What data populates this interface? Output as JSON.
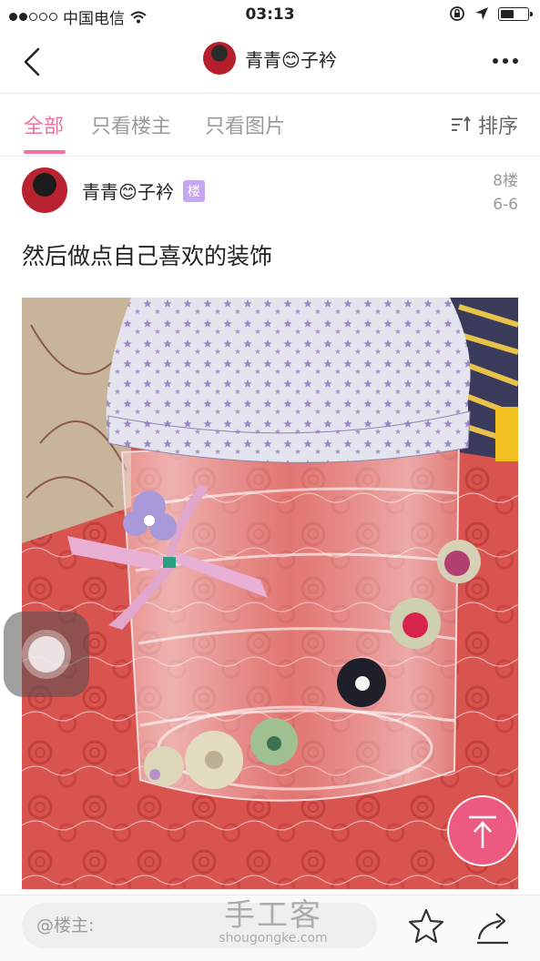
{
  "status_bar": {
    "carrier": "中国电信",
    "time": "03:13",
    "signal_bars": 2,
    "battery_level": 0.5
  },
  "nav": {
    "title": "青青😊子衿"
  },
  "tabs": [
    {
      "label": "全部",
      "active": true
    },
    {
      "label": "只看楼主",
      "active": false
    },
    {
      "label": "只看图片",
      "active": false
    }
  ],
  "sort_label": "排序",
  "post": {
    "author": "青青😊子衿",
    "badge": "楼",
    "floor": "8楼",
    "date": "6-6",
    "text": "然后做点自己喜欢的装饰"
  },
  "reply_placeholder": "@楼主:",
  "watermark": {
    "main": "手工客",
    "sub": "shougongke.com"
  },
  "colors": {
    "accent": "#f0729a",
    "badge": "#c6a6f0",
    "scroll_top": "#ec5a82"
  },
  "icons": {
    "back": "chevron-left-icon",
    "more": "more-horizontal-icon",
    "sort": "sort-icon",
    "star": "star-icon",
    "share": "share-icon",
    "scroll_top": "arrow-up-icon"
  }
}
